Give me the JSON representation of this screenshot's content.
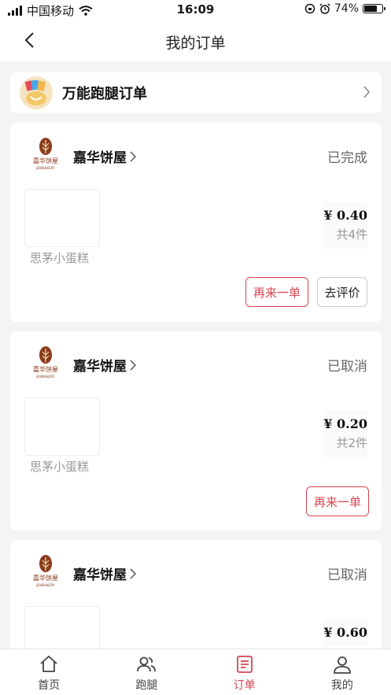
{
  "status_bar": {
    "carrier": "中国移动",
    "time": "16:09",
    "battery": "74%",
    "battery_level": 0.74
  },
  "nav": {
    "title": "我的订单"
  },
  "errand": {
    "title": "万能跑腿订单"
  },
  "orders": [
    {
      "store": "嘉华饼屋",
      "logo_text": "嘉华饼屋",
      "logo_sub": "JEWBAKERY",
      "status": "已完成",
      "product": "思茅小蛋糕",
      "price": "¥ 0.40",
      "count": "共4件",
      "reorder_label": "再来一单",
      "review_label": "去评价"
    },
    {
      "store": "嘉华饼屋",
      "logo_text": "嘉华饼屋",
      "logo_sub": "JEWBAKERY",
      "status": "已取消",
      "product": "思茅小蛋糕",
      "price": "¥ 0.20",
      "count": "共2件",
      "reorder_label": "再来一单"
    },
    {
      "store": "嘉华饼屋",
      "logo_text": "嘉华饼屋",
      "logo_sub": "JEWBAKERY",
      "status": "已取消",
      "price": "¥ 0.60"
    }
  ],
  "tabs": [
    {
      "label": "首页",
      "icon": "home-icon"
    },
    {
      "label": "跑腿",
      "icon": "users-icon"
    },
    {
      "label": "订单",
      "icon": "order-icon",
      "active": true
    },
    {
      "label": "我的",
      "icon": "profile-icon"
    }
  ],
  "colors": {
    "accent": "#d8434f",
    "background": "#f4f4f4",
    "logo_brown": "#8a3b1c"
  }
}
